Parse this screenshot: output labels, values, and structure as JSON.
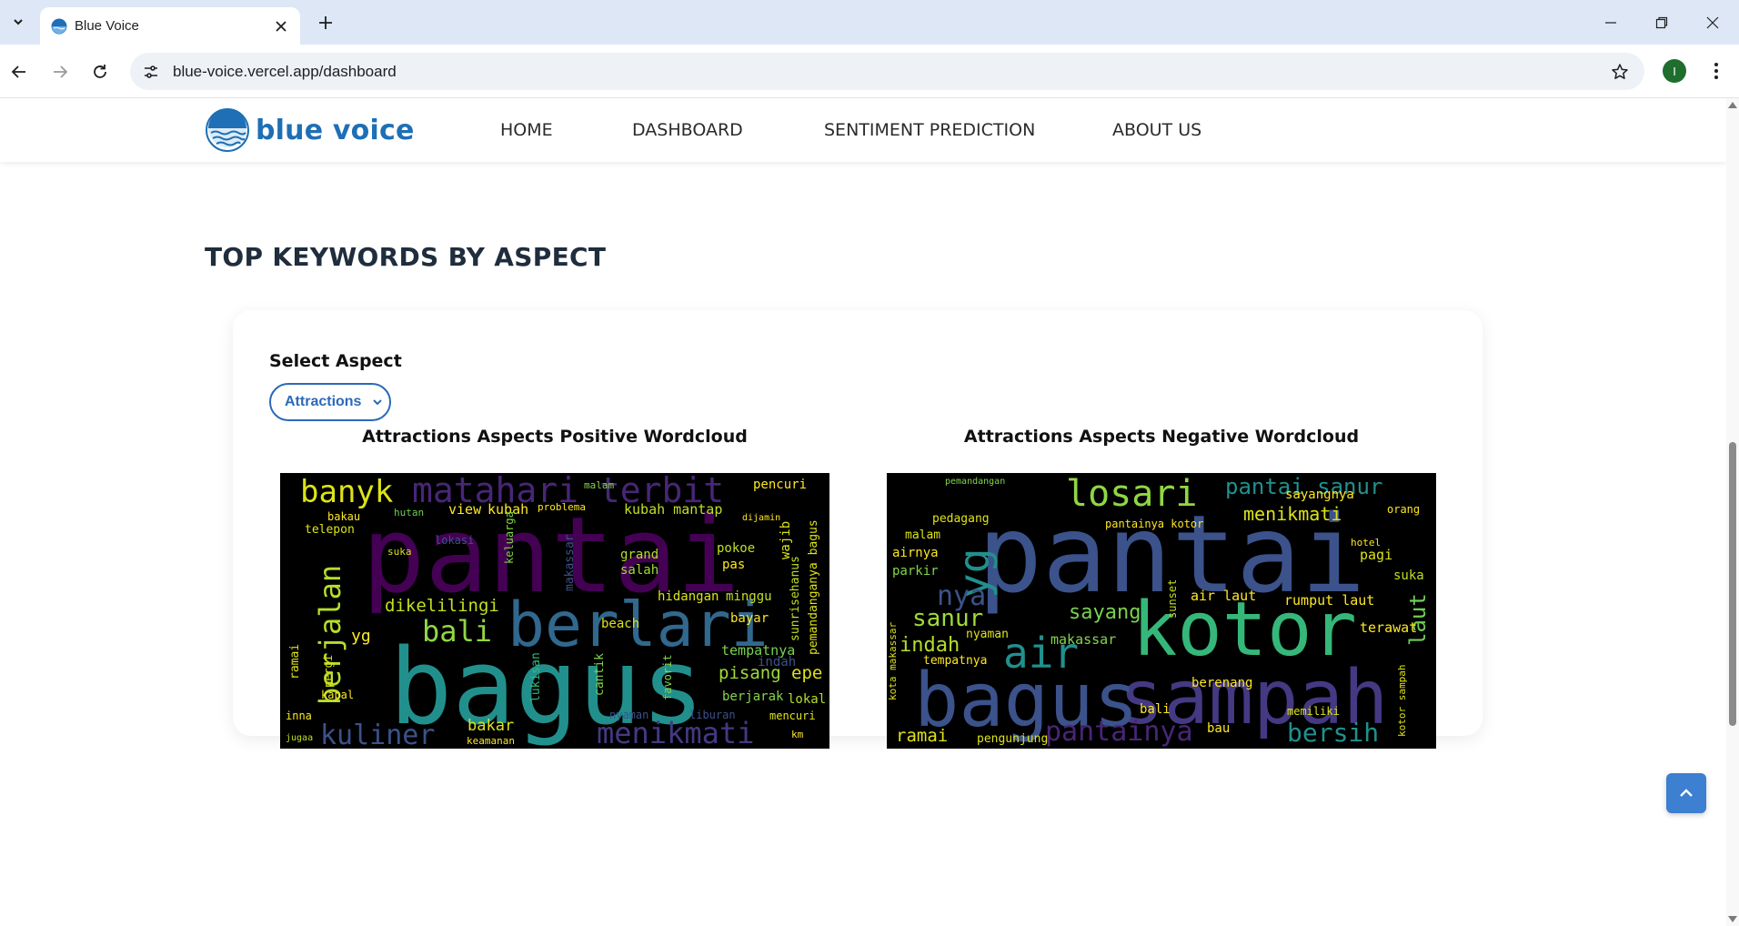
{
  "browser": {
    "tab_title": "Blue Voice",
    "url": "blue-voice.vercel.app/dashboard",
    "profile_initial": "I"
  },
  "site": {
    "logo_text": "blue voice",
    "nav": [
      "HOME",
      "DASHBOARD",
      "SENTIMENT PREDICTION",
      "ABOUT US"
    ]
  },
  "section": {
    "title": "TOP KEYWORDS BY ASPECT",
    "select_label": "Select Aspect",
    "select_value": "Attractions",
    "positive_title": "Attractions Aspects Positive Wordcloud",
    "negative_title": "Attractions Aspects Negative Wordcloud"
  },
  "wordclouds": {
    "positive_words": [
      "pantai",
      "bagus",
      "berlari",
      "matahari terbit",
      "banyk",
      "berjalan",
      "bali",
      "kuliner",
      "menikmati",
      "dikelilingi",
      "view",
      "kubah",
      "problema",
      "kubah mantap",
      "pisang",
      "epe",
      "bayar",
      "tempatnya",
      "berjarak",
      "lokal",
      "bakar",
      "keamanan",
      "lukisan",
      "cantik",
      "makassar",
      "grand",
      "salah",
      "hidangan",
      "minggu",
      "pokoe",
      "pas",
      "wajib",
      "sunrisehanus",
      "pemandanganya bagus",
      "pencuri",
      "bakau",
      "hutan",
      "telepon",
      "keluarga",
      "lokasi",
      "beach",
      "indah",
      "yg",
      "ramai",
      "kapal",
      "inna",
      "jugaa",
      "km",
      "nyaman",
      "liburan",
      "favorit",
      "mencuri",
      "dijamin",
      "pergi",
      "suka",
      "malam"
    ],
    "negative_words": [
      "pantai",
      "kotor",
      "sampah",
      "bagus",
      "losari",
      "pantai sanur",
      "air",
      "yg",
      "nya",
      "sanur",
      "indah",
      "sayang",
      "menikmati",
      "pantainya",
      "bersih",
      "ramai",
      "laut",
      "air laut",
      "rumput laut",
      "terawat",
      "pagi",
      "suka",
      "makassar",
      "pedagang",
      "malam",
      "airnya",
      "parkir",
      "tempatnya",
      "nyaman",
      "berenang",
      "bali",
      "bau",
      "pengunjung",
      "sunset",
      "sayangnya",
      "orang",
      "hotel",
      "kota makassar",
      "pantainya kotor",
      "memiliki",
      "kotor sampah",
      "pemandangan"
    ],
    "colors": {
      "purple": "#440154",
      "indigo": "#3b528b",
      "blue": "#31688e",
      "teal": "#21908d",
      "green": "#35b779",
      "lime": "#90d743",
      "yellow": "#dde318"
    }
  }
}
